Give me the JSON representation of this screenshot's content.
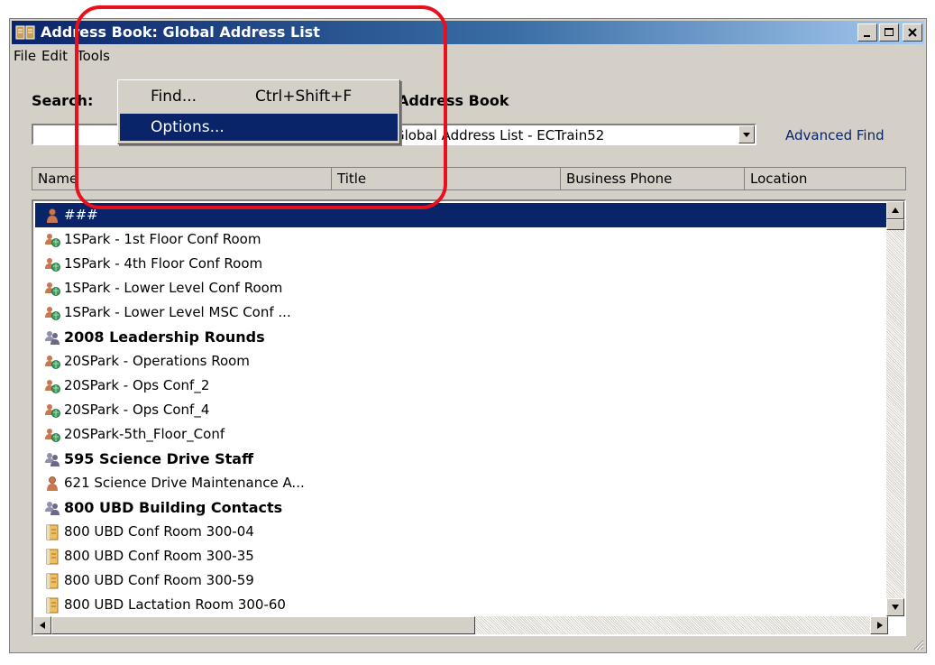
{
  "window": {
    "title": "Address Book: Global Address List"
  },
  "menubar": {
    "items": [
      "File",
      "Edit",
      "Tools"
    ]
  },
  "search": {
    "label": "Search:",
    "value": ""
  },
  "address_book": {
    "label": "Address Book",
    "selected": "Global Address List - ECTrain52"
  },
  "advanced_find": "Advanced Find",
  "columns": [
    "Name",
    "Title",
    "Business Phone",
    "Location"
  ],
  "tools_menu": {
    "items": [
      {
        "label": "Find...",
        "shortcut": "Ctrl+Shift+F"
      },
      {
        "label": "Options...",
        "shortcut": ""
      }
    ]
  },
  "rows": [
    {
      "name": "###",
      "icon": "user-icon",
      "bold": false,
      "selected": true
    },
    {
      "name": "1SPark - 1st Floor Conf Room",
      "icon": "room-icon",
      "bold": false
    },
    {
      "name": "1SPark - 4th Floor Conf Room",
      "icon": "room-icon",
      "bold": false
    },
    {
      "name": "1SPark - Lower Level Conf Room",
      "icon": "room-icon",
      "bold": false
    },
    {
      "name": "1SPark - Lower Level MSC Conf ...",
      "icon": "room-icon",
      "bold": false
    },
    {
      "name": "2008 Leadership Rounds",
      "icon": "group-icon",
      "bold": true
    },
    {
      "name": "20SPark - Operations Room",
      "icon": "room-icon",
      "bold": false
    },
    {
      "name": "20SPark - Ops Conf_2",
      "icon": "room-icon",
      "bold": false
    },
    {
      "name": "20SPark - Ops Conf_4",
      "icon": "room-icon",
      "bold": false
    },
    {
      "name": "20SPark-5th_Floor_Conf",
      "icon": "room-icon",
      "bold": false
    },
    {
      "name": "595 Science Drive Staff",
      "icon": "group-icon",
      "bold": true
    },
    {
      "name": "621 Science Drive Maintenance A...",
      "icon": "user-icon",
      "bold": false
    },
    {
      "name": "800 UBD Building Contacts",
      "icon": "group-icon",
      "bold": true
    },
    {
      "name": "800 UBD Conf Room 300-04",
      "icon": "contact-card-icon",
      "bold": false
    },
    {
      "name": "800 UBD Conf Room 300-35",
      "icon": "contact-card-icon",
      "bold": false
    },
    {
      "name": "800 UBD Conf Room 300-59",
      "icon": "contact-card-icon",
      "bold": false
    },
    {
      "name": "800 UBD Lactation Room 300-60",
      "icon": "contact-card-icon",
      "bold": false
    }
  ],
  "colors": {
    "title_bar": "#0a246a",
    "selection": "#0a246a",
    "callout": "#e8101a",
    "link": "#0a246a"
  }
}
